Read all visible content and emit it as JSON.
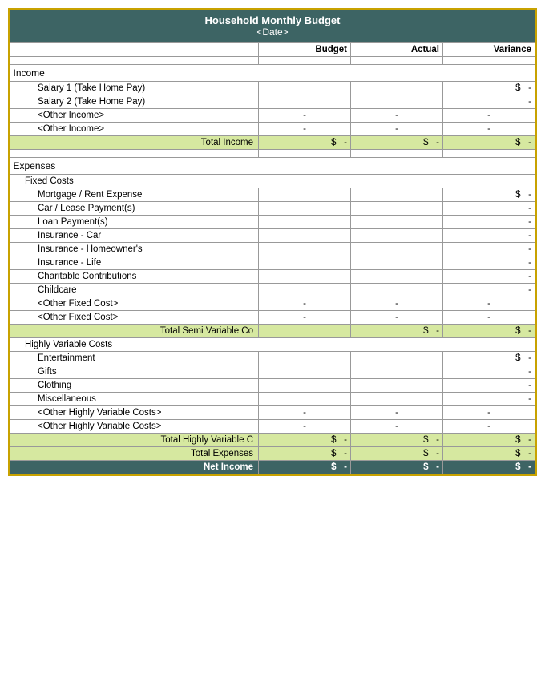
{
  "header": {
    "title": "Household Monthly Budget",
    "date": "<Date>"
  },
  "columns": {
    "budget": "Budget",
    "actual": "Actual",
    "variance": "Variance"
  },
  "sections": {
    "income": {
      "label": "Income",
      "items": [
        {
          "label": "Salary 1 (Take Home Pay)",
          "budget": "",
          "actual": "",
          "variance_dollar": "$",
          "variance": "-"
        },
        {
          "label": "Salary 2 (Take Home Pay)",
          "budget": "",
          "actual": "",
          "variance_dollar": "",
          "variance": "-"
        },
        {
          "label": "<Other Income>",
          "budget": "-",
          "actual": "-",
          "variance_dollar": "",
          "variance": "-"
        },
        {
          "label": "<Other Income>",
          "budget": "-",
          "actual": "-",
          "variance_dollar": "",
          "variance": "-"
        }
      ],
      "total_label": "Total Income",
      "total": {
        "b_dollar": "$",
        "b_val": "-",
        "a_dollar": "$",
        "a_val": "-",
        "v_dollar": "$",
        "v_val": "-"
      }
    },
    "expenses": {
      "label": "Expenses",
      "fixed_costs": {
        "label": "Fixed Costs",
        "items": [
          {
            "label": "Mortgage / Rent Expense",
            "budget": "",
            "actual": "",
            "variance_dollar": "$",
            "variance": "-"
          },
          {
            "label": "Car / Lease Payment(s)",
            "budget": "",
            "actual": "",
            "variance_dollar": "",
            "variance": "-"
          },
          {
            "label": "Loan Payment(s)",
            "budget": "",
            "actual": "",
            "variance_dollar": "",
            "variance": "-"
          },
          {
            "label": "Insurance - Car",
            "budget": "",
            "actual": "",
            "variance_dollar": "",
            "variance": "-"
          },
          {
            "label": "Insurance - Homeowner's",
            "budget": "",
            "actual": "",
            "variance_dollar": "",
            "variance": "-"
          },
          {
            "label": "Insurance - Life",
            "budget": "",
            "actual": "",
            "variance_dollar": "",
            "variance": "-"
          },
          {
            "label": "Charitable Contributions",
            "budget": "",
            "actual": "",
            "variance_dollar": "",
            "variance": "-"
          },
          {
            "label": "Childcare",
            "budget": "",
            "actual": "",
            "variance_dollar": "",
            "variance": "-"
          },
          {
            "label": "<Other Fixed Cost>",
            "budget": "-",
            "actual": "-",
            "variance_dollar": "",
            "variance": "-"
          },
          {
            "label": "<Other Fixed Cost>",
            "budget": "-",
            "actual": "-",
            "variance_dollar": "",
            "variance": "-"
          }
        ],
        "total_label": "Total Semi Variable Co",
        "total": {
          "b_dollar": "",
          "b_val": "",
          "a_dollar": "$",
          "a_val": "-",
          "v_dollar": "$",
          "v_val": "-"
        }
      },
      "highly_variable": {
        "label": "Highly Variable Costs",
        "items": [
          {
            "label": "Entertainment",
            "budget": "",
            "actual": "",
            "variance_dollar": "$",
            "variance": "-"
          },
          {
            "label": "Gifts",
            "budget": "",
            "actual": "",
            "variance_dollar": "",
            "variance": "-"
          },
          {
            "label": "Clothing",
            "budget": "",
            "actual": "",
            "variance_dollar": "",
            "variance": "-"
          },
          {
            "label": "Miscellaneous",
            "budget": "",
            "actual": "",
            "variance_dollar": "",
            "variance": "-"
          },
          {
            "label": "<Other Highly Variable Costs>",
            "budget": "-",
            "actual": "-",
            "variance_dollar": "",
            "variance": "-"
          },
          {
            "label": "<Other Highly Variable Costs>",
            "budget": "-",
            "actual": "-",
            "variance_dollar": "",
            "variance": "-"
          }
        ],
        "total_label": "Total Highly Variable C",
        "total": {
          "b_dollar": "$",
          "b_val": "-",
          "a_dollar": "$",
          "a_val": "-",
          "v_dollar": "$",
          "v_val": "-"
        }
      },
      "total_expenses_label": "Total Expenses",
      "total_expenses": {
        "b_dollar": "$",
        "b_val": "-",
        "a_dollar": "$",
        "a_val": "-",
        "v_dollar": "$",
        "v_val": "-"
      }
    },
    "net_income": {
      "label": "Net Income",
      "values": {
        "b_dollar": "$",
        "b_val": "-",
        "a_dollar": "$",
        "a_val": "-",
        "v_dollar": "$",
        "v_val": "-"
      }
    }
  }
}
